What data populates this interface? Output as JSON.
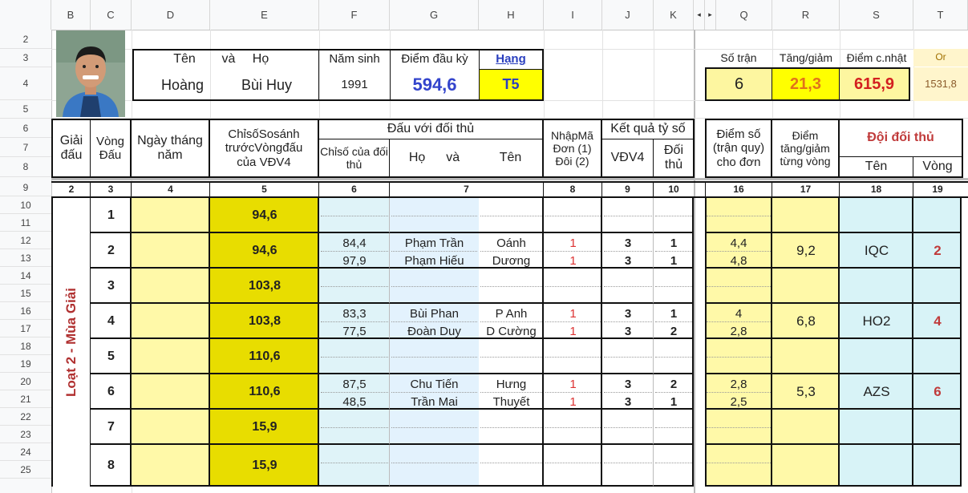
{
  "columns": [
    "B",
    "C",
    "D",
    "E",
    "F",
    "G",
    "H",
    "I",
    "J",
    "K",
    "Q",
    "R",
    "S",
    "T"
  ],
  "rows": [
    "2",
    "3",
    "4",
    "5",
    "6",
    "7",
    "8",
    "9",
    "10",
    "11",
    "12",
    "13",
    "14",
    "15",
    "16",
    "17",
    "18",
    "19",
    "20",
    "21",
    "22",
    "23",
    "24",
    "25"
  ],
  "header": {
    "ten_va_ho": [
      "Tên",
      "và",
      "Họ"
    ],
    "nam_sinh_label": "Năm sinh",
    "diem_dau_ky_label": "Điểm đầu kỳ",
    "hang_label": "Hạng",
    "first_name": "Hoàng",
    "last_name": "Bùi Huy",
    "nam_sinh": "1991",
    "diem_dau_ky": "594,6",
    "hang": "T5",
    "so_tran_label": "Số trận",
    "tang_giam_label": "Tăng/giảm",
    "diem_cnhat_label": "Điểm c.nhật",
    "or_label": "Or",
    "so_tran": "6",
    "tang_giam": "21,3",
    "diem_cnhat": "615,9",
    "or_value": "1531,8"
  },
  "table_header": {
    "giai_dau": "Giải đấu",
    "vong_dau": "Vòng Đấu",
    "ngay_thang_nam": "Ngày tháng năm",
    "chiso": "ChỉsốSosánh trướcVòngđấu của VĐV4",
    "dau_voi_doi_thu": "Đấu với đối thủ",
    "chiso_doi_thu": "Chỉsố của đối thủ",
    "ho": "Họ",
    "va": "và",
    "ten": "Tên",
    "nhap_ma": "NhậpMã Đơn (1) Đôi (2)",
    "ket_qua": "Kết quả tỷ số",
    "vdv4": "VĐV4",
    "doi_thu": "Đối thủ",
    "diem_so": "Điểm số (trận quy) cho đơn",
    "diem_tang_giam": "Điểm tăng/giảm từng vòng",
    "doi_doi_thu": "Đội đối thủ",
    "doi_ten": "Tên",
    "doi_vong": "Vòng"
  },
  "col_numbers": [
    "2",
    "3",
    "4",
    "5",
    "6",
    "7",
    "8",
    "9",
    "10",
    "16",
    "17",
    "18",
    "19"
  ],
  "season_label": "Loạt 2 - Mùa Giải",
  "rounds": [
    {
      "vong": "1",
      "chiso": "94,6",
      "matches": []
    },
    {
      "vong": "2",
      "chiso": "94,6",
      "tang_giam": "9,2",
      "doi_ten": "IQC",
      "doi_vong": "2",
      "matches": [
        {
          "chiso": "84,4",
          "ho": "Phạm Trần",
          "ten": "Oánh",
          "ma": "1",
          "vdv4": "3",
          "doi_thu": "1",
          "diem": "4,4"
        },
        {
          "chiso": "97,9",
          "ho": "Phạm Hiếu",
          "ten": "Dương",
          "ma": "1",
          "vdv4": "3",
          "doi_thu": "1",
          "diem": "4,8"
        }
      ]
    },
    {
      "vong": "3",
      "chiso": "103,8",
      "matches": []
    },
    {
      "vong": "4",
      "chiso": "103,8",
      "tang_giam": "6,8",
      "doi_ten": "HO2",
      "doi_vong": "4",
      "matches": [
        {
          "chiso": "83,3",
          "ho": "Bùi Phan",
          "ten": "P Anh",
          "ma": "1",
          "vdv4": "3",
          "doi_thu": "1",
          "diem": "4"
        },
        {
          "chiso": "77,5",
          "ho": "Đoàn Duy",
          "ten": "D Cường",
          "ma": "1",
          "vdv4": "3",
          "doi_thu": "2",
          "diem": "2,8"
        }
      ]
    },
    {
      "vong": "5",
      "chiso": "110,6",
      "matches": []
    },
    {
      "vong": "6",
      "chiso": "110,6",
      "tang_giam": "5,3",
      "doi_ten": "AZS",
      "doi_vong": "6",
      "matches": [
        {
          "chiso": "87,5",
          "ho": "Chu Tiến",
          "ten": "Hưng",
          "ma": "1",
          "vdv4": "3",
          "doi_thu": "2",
          "diem": "2,8"
        },
        {
          "chiso": "48,5",
          "ho": "Trần Mai",
          "ten": "Thuyết",
          "ma": "1",
          "vdv4": "3",
          "doi_thu": "1",
          "diem": "2,5"
        }
      ]
    },
    {
      "vong": "7",
      "chiso": "15,9",
      "matches": []
    },
    {
      "vong": "8",
      "chiso": "15,9",
      "matches": []
    }
  ],
  "icons": {
    "photo": "player-photo",
    "arrow_left": "◂",
    "arrow_right": "▸"
  }
}
